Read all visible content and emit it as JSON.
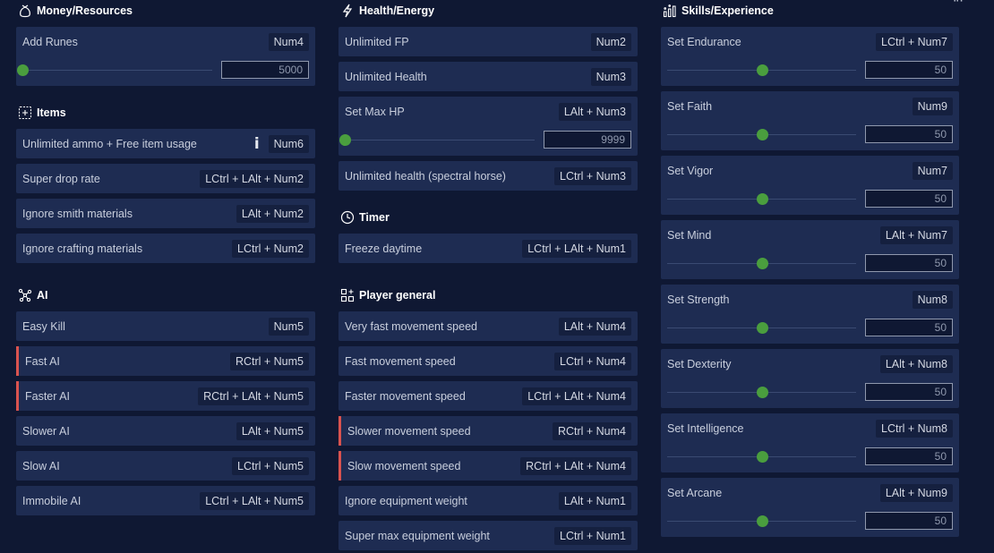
{
  "sections": {
    "money": {
      "title": "Money/Resources",
      "rows": [
        {
          "label": "Add Runes",
          "hotkey": "Num4",
          "slider": {
            "value": "5000",
            "fraction": 0.0
          }
        }
      ]
    },
    "items": {
      "title": "Items",
      "rows": [
        {
          "label": "Unlimited ammo + Free item usage",
          "hotkey": "Num6",
          "info": "i"
        },
        {
          "label": "Super drop rate",
          "hotkey": "LCtrl + LAlt + Num2"
        },
        {
          "label": "Ignore smith materials",
          "hotkey": "LAlt + Num2"
        },
        {
          "label": "Ignore crafting materials",
          "hotkey": "LCtrl + Num2"
        }
      ]
    },
    "ai": {
      "title": "AI",
      "rows": [
        {
          "label": "Easy Kill",
          "hotkey": "Num5",
          "active": false
        },
        {
          "label": "Fast AI",
          "hotkey": "RCtrl + Num5",
          "active": true
        },
        {
          "label": "Faster AI",
          "hotkey": "RCtrl + LAlt + Num5",
          "active": true
        },
        {
          "label": "Slower AI",
          "hotkey": "LAlt + Num5",
          "active": false
        },
        {
          "label": "Slow AI",
          "hotkey": "LCtrl + Num5",
          "active": false
        },
        {
          "label": "Immobile AI",
          "hotkey": "LCtrl + LAlt + Num5",
          "active": false
        }
      ]
    },
    "health": {
      "title": "Health/Energy",
      "rows": [
        {
          "label": "Unlimited FP",
          "hotkey": "Num2"
        },
        {
          "label": "Unlimited Health",
          "hotkey": "Num3"
        },
        {
          "label": "Set Max HP",
          "hotkey": "LAlt + Num3",
          "slider": {
            "value": "9999",
            "fraction": 0.0
          }
        },
        {
          "label": "Unlimited health (spectral horse)",
          "hotkey": "LCtrl + Num3"
        }
      ]
    },
    "timer": {
      "title": "Timer",
      "rows": [
        {
          "label": "Freeze daytime",
          "hotkey": "LCtrl + LAlt + Num1"
        }
      ]
    },
    "player": {
      "title": "Player general",
      "rows": [
        {
          "label": "Very fast movement speed",
          "hotkey": "LAlt + Num4",
          "active": false
        },
        {
          "label": "Fast movement speed",
          "hotkey": "LCtrl + Num4",
          "active": false
        },
        {
          "label": "Faster movement speed",
          "hotkey": "LCtrl + LAlt + Num4",
          "active": false
        },
        {
          "label": "Slower movement speed",
          "hotkey": "RCtrl + Num4",
          "active": true
        },
        {
          "label": "Slow movement speed",
          "hotkey": "RCtrl + LAlt + Num4",
          "active": true
        },
        {
          "label": "Ignore equipment weight",
          "hotkey": "LAlt + Num1",
          "active": false
        },
        {
          "label": "Super max equipment weight",
          "hotkey": "LCtrl + Num1",
          "active": false
        }
      ]
    },
    "skills": {
      "title": "Skills/Experience",
      "rows": [
        {
          "label": "Set Endurance",
          "hotkey": "LCtrl + Num7",
          "slider": {
            "value": "50",
            "fraction": 0.5
          }
        },
        {
          "label": "Set Faith",
          "hotkey": "Num9",
          "slider": {
            "value": "50",
            "fraction": 0.5
          }
        },
        {
          "label": "Set Vigor",
          "hotkey": "Num7",
          "slider": {
            "value": "50",
            "fraction": 0.5
          }
        },
        {
          "label": "Set Mind",
          "hotkey": "LAlt + Num7",
          "slider": {
            "value": "50",
            "fraction": 0.5
          }
        },
        {
          "label": "Set Strength",
          "hotkey": "Num8",
          "slider": {
            "value": "50",
            "fraction": 0.5
          }
        },
        {
          "label": "Set Dexterity",
          "hotkey": "LAlt + Num8",
          "slider": {
            "value": "50",
            "fraction": 0.5
          }
        },
        {
          "label": "Set Intelligence",
          "hotkey": "LCtrl + Num8",
          "slider": {
            "value": "50",
            "fraction": 0.5
          }
        },
        {
          "label": "Set Arcane",
          "hotkey": "LAlt + Num9",
          "slider": {
            "value": "50",
            "fraction": 0.5
          }
        }
      ]
    }
  },
  "icons": {
    "money": "money-bag-icon",
    "items": "plus-box-icon",
    "ai": "network-icon",
    "health": "lightning-icon",
    "timer": "clock-icon",
    "player": "grid-plus-icon",
    "skills": "bar-chart-icon"
  },
  "colors": {
    "background": "#0f1833",
    "row": "#1e2c52",
    "active_marker": "#d9534f",
    "slider_thumb": "#4a9e3e"
  }
}
